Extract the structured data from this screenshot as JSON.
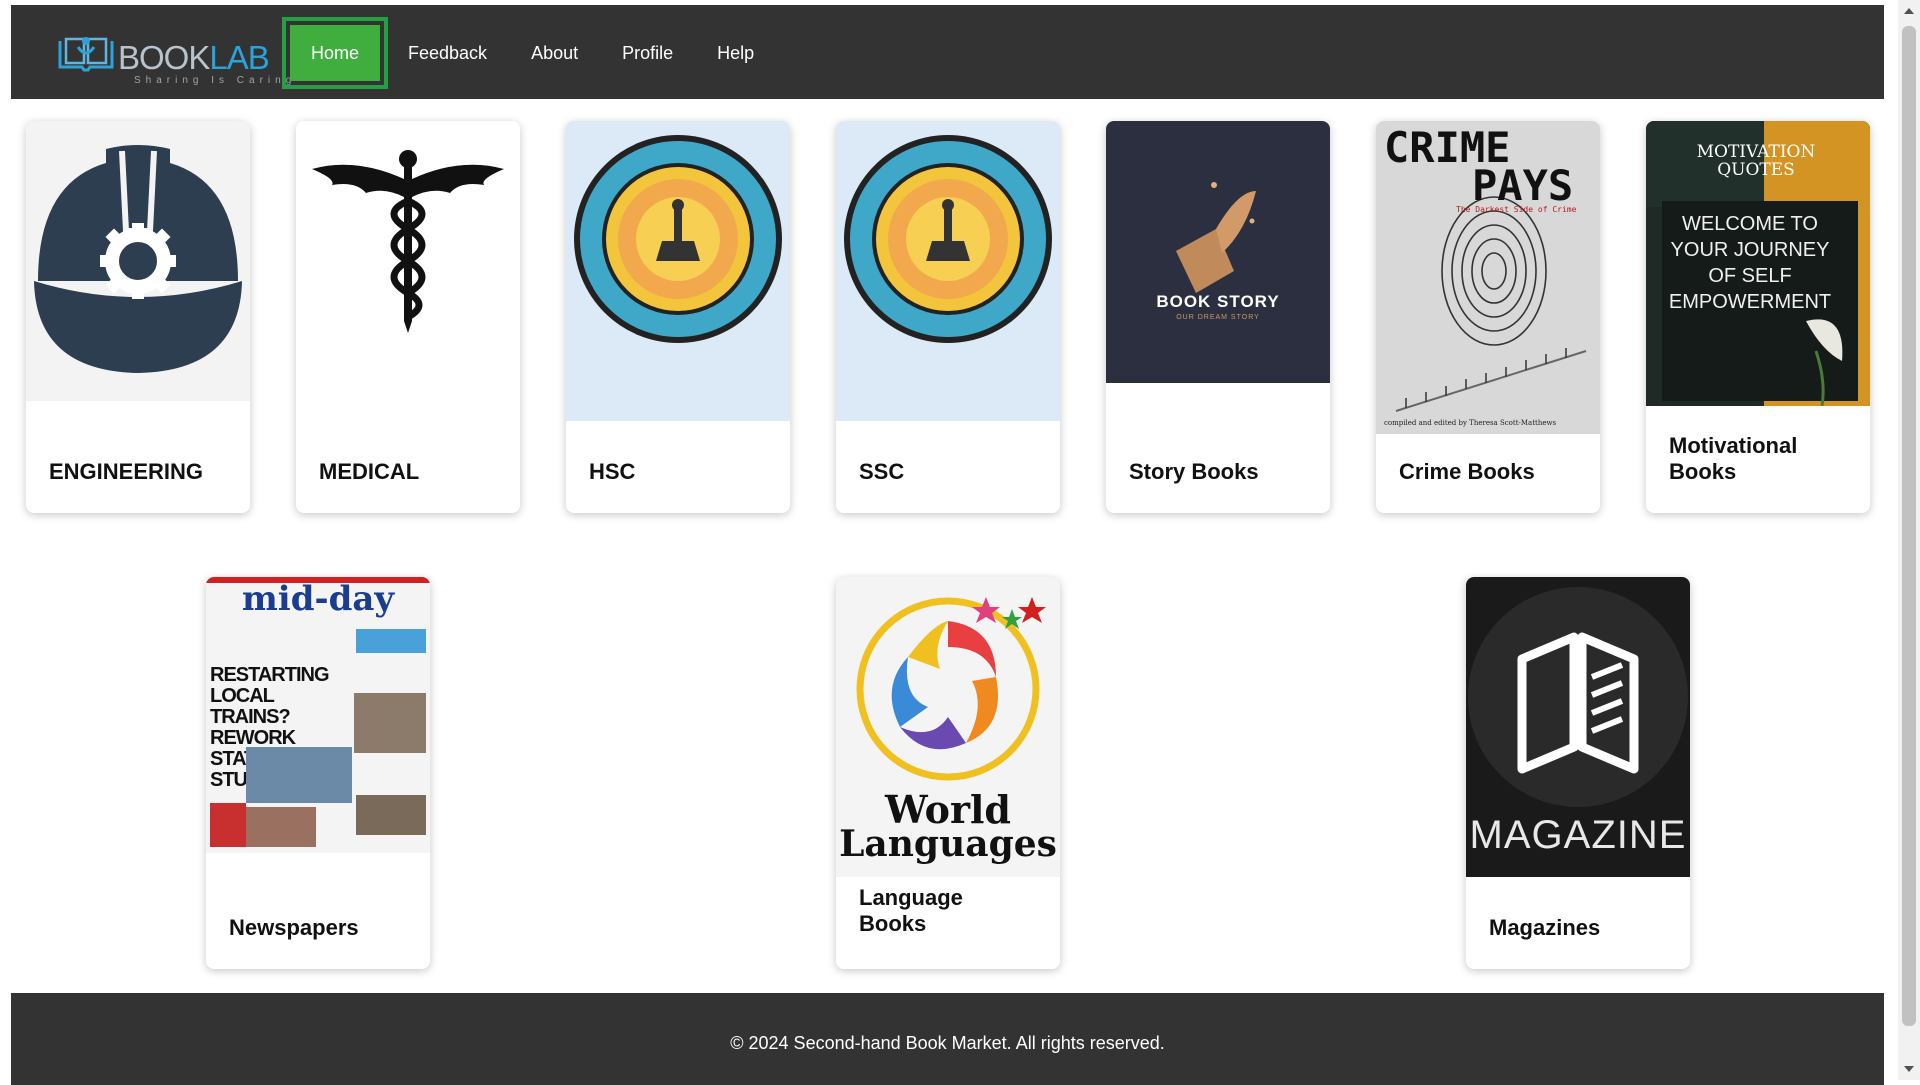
{
  "header": {
    "logo_text_a": "BOOK",
    "logo_text_b": "LAB",
    "tagline": "Sharing Is Caring",
    "nav": [
      "Home",
      "Feedback",
      "About",
      "Profile",
      "Help"
    ]
  },
  "categories_row1": [
    {
      "label": "ENGINEERING",
      "icon": "hard-hat-gear-icon"
    },
    {
      "label": "MEDICAL",
      "icon": "caduceus-icon"
    },
    {
      "label": "HSC",
      "icon": "board-seal-icon"
    },
    {
      "label": "SSC",
      "icon": "board-seal-icon"
    },
    {
      "label": "Story Books",
      "icon": "quill-book-icon",
      "cover_title": "BOOK STORY",
      "cover_sub": "OUR DREAM STORY"
    },
    {
      "label": "Crime Books",
      "icon": "fingerprint-icon",
      "cover_title_1": "CRIME",
      "cover_title_2": "PAYS",
      "cover_sub": "The Darkest Side of Crime",
      "cover_credit": "compiled and edited by Theresa Scott-Matthews"
    },
    {
      "label_1": "Motivational",
      "label_2": "Books",
      "icon": "flower-icon",
      "cover_top": "MOTIVATION QUOTES",
      "cover_text": "WELCOME TO YOUR JOURNEY OF SELF EMPOWERMENT"
    }
  ],
  "categories_row2": [
    {
      "label": "Newspapers",
      "icon": "newspaper-icon",
      "masthead": "mid-day",
      "headline": "RESTARTING LOCAL TRAINS? REWORK STATIONS: STUDY"
    },
    {
      "label_1": "Language",
      "label_2": "Books",
      "icon": "languages-swirl-icon",
      "cover_1": "World",
      "cover_2": "Languages"
    },
    {
      "label": "Magazines",
      "icon": "open-book-icon",
      "cover": "MAGAZINE"
    }
  ],
  "footer": {
    "copyright": "© 2024 Second-hand Book Market. All rights reserved."
  },
  "colors": {
    "nav_bg": "#333333",
    "active_bg": "#3fae3f",
    "active_border": "#24a043",
    "engineering_icon": "#2c3e50"
  }
}
